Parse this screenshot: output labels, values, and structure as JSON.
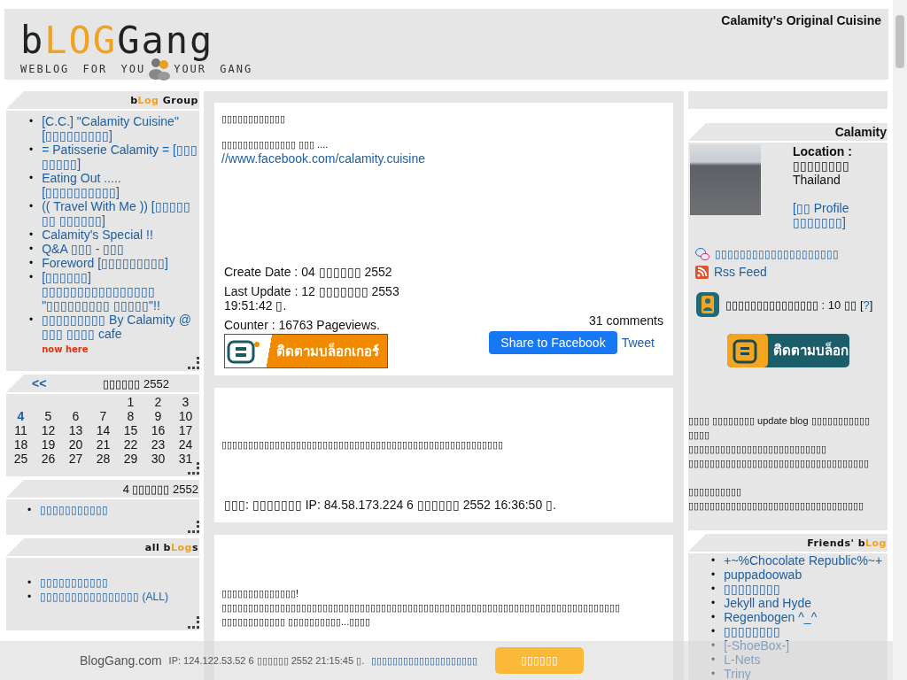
{
  "header": {
    "logo_parts": [
      {
        "text": "b",
        "accent": false
      },
      {
        "text": "LOG",
        "accent": true
      },
      {
        "text": "Gang",
        "accent": false
      }
    ],
    "tagline_left": "WEBLOG FOR YOU",
    "tagline_right": "YOUR GANG",
    "blog_title": "Calamity's Original Cuisine"
  },
  "left": {
    "group": {
      "title_parts": [
        {
          "text": "b",
          "accent": false
        },
        {
          "text": "Log",
          "accent": true
        },
        {
          "text": " Group",
          "accent": false
        }
      ],
      "marker": "•",
      "items": [
        {
          "text": "[C.C.] \"Calamity Cuisine\" [▯▯▯▯▯▯▯▯▯]"
        },
        {
          "text": "= Patisserie Calamity = [▯▯▯ ▯▯▯▯▯]"
        },
        {
          "text": "Eating Out ..... [▯▯▯▯▯▯▯▯▯▯]"
        },
        {
          "text": "(( Travel With Me )) [▯▯▯▯▯ ▯▯ ▯▯▯▯▯▯]"
        },
        {
          "text": "Calamity's Special !!"
        },
        {
          "text": "Q&A ▯▯▯ - ▯▯▯"
        },
        {
          "text": "Foreword [▯▯▯▯▯▯▯▯▯]"
        },
        {
          "text": "[▯▯▯▯▯▯] ▯▯▯▯▯▯▯▯▯▯▯▯▯▯▯▯ \"▯▯▯▯▯▯▯▯▯ ▯▯▯▯▯\"!!"
        },
        {
          "text": "▯▯▯▯▯▯▯▯▯ By Calamity @ ▯▯▯ ▯▯▯▯ cafe",
          "badge": "now here"
        }
      ]
    },
    "calendar": {
      "prev": "<<",
      "month": "▯▯▯▯▯▯ 2552",
      "weeks": [
        [
          {
            "kind": "blank"
          },
          {
            "kind": "blank"
          },
          {
            "kind": "blank"
          },
          {
            "kind": "blank"
          },
          {
            "kind": "day",
            "label": "1",
            "selected": false
          },
          {
            "kind": "day",
            "label": "2",
            "selected": false
          },
          {
            "kind": "day",
            "label": "3",
            "selected": false
          }
        ],
        [
          {
            "kind": "day",
            "label": "4",
            "selected": true
          },
          {
            "kind": "day",
            "label": "5",
            "selected": false
          },
          {
            "kind": "day",
            "label": "6",
            "selected": false
          },
          {
            "kind": "day",
            "label": "7",
            "selected": false
          },
          {
            "kind": "day",
            "label": "8",
            "selected": false
          },
          {
            "kind": "day",
            "label": "9",
            "selected": false
          },
          {
            "kind": "day",
            "label": "10",
            "selected": false
          }
        ],
        [
          {
            "kind": "day",
            "label": "11",
            "selected": false
          },
          {
            "kind": "day",
            "label": "12",
            "selected": false
          },
          {
            "kind": "day",
            "label": "13",
            "selected": false
          },
          {
            "kind": "day",
            "label": "14",
            "selected": false
          },
          {
            "kind": "day",
            "label": "15",
            "selected": false
          },
          {
            "kind": "day",
            "label": "16",
            "selected": false
          },
          {
            "kind": "day",
            "label": "17",
            "selected": false
          }
        ],
        [
          {
            "kind": "day",
            "label": "18",
            "selected": false
          },
          {
            "kind": "day",
            "label": "19",
            "selected": false
          },
          {
            "kind": "day",
            "label": "20",
            "selected": false
          },
          {
            "kind": "day",
            "label": "21",
            "selected": false
          },
          {
            "kind": "day",
            "label": "22",
            "selected": false
          },
          {
            "kind": "day",
            "label": "23",
            "selected": false
          },
          {
            "kind": "day",
            "label": "24",
            "selected": false
          }
        ],
        [
          {
            "kind": "day",
            "label": "25",
            "selected": false
          },
          {
            "kind": "day",
            "label": "26",
            "selected": false
          },
          {
            "kind": "day",
            "label": "27",
            "selected": false
          },
          {
            "kind": "day",
            "label": "28",
            "selected": false
          },
          {
            "kind": "day",
            "label": "29",
            "selected": false
          },
          {
            "kind": "day",
            "label": "30",
            "selected": false
          },
          {
            "kind": "day",
            "label": "31",
            "selected": false
          }
        ]
      ]
    },
    "day": {
      "title": "4 ▯▯▯▯▯▯ 2552",
      "marker": "•",
      "items": [
        "▯▯▯▯▯▯▯▯▯▯▯"
      ]
    },
    "all_blogs": {
      "title_parts": [
        {
          "text": "all b",
          "accent": false
        },
        {
          "text": "Log",
          "accent": true
        },
        {
          "text": "s",
          "accent": false
        }
      ],
      "marker": "•",
      "items": [
        "▯▯▯▯▯▯▯▯▯▯▯",
        "▯▯▯▯▯▯▯▯▯▯▯▯▯▯▯▯ (ALL)"
      ]
    }
  },
  "entry": {
    "title": "▯▯▯▯▯▯▯▯▯▯▯▯",
    "text": "▯▯▯▯▯▯▯▯▯▯▯▯▯▯ ▯▯▯ ....",
    "link": "//www.facebook.com/calamity.cuisine",
    "create_date": "Create Date : 04 ▯▯▯▯▯▯ 2552",
    "last_update": "Last Update : 12 ▯▯▯▯▯▯▯ 2553 19:51:42 ▯.",
    "counter": "Counter : 16763 Pageviews.",
    "comments": "31 comments",
    "follow_badge": "ติดตามบล็อกเกอร์",
    "share": "Share to Facebook",
    "tweet": "Tweet"
  },
  "comments": [
    {
      "text": "▯▯▯▯▯▯▯▯▯▯▯▯▯▯▯▯▯▯▯▯▯▯▯▯▯▯▯▯▯▯▯▯▯▯▯▯▯▯▯▯▯▯▯▯▯▯▯▯▯▯▯▯▯",
      "footer": "▯▯▯: ▯▯▯▯▯▯▯ IP: 84.58.173.224 6 ▯▯▯▯▯▯ 2552 16:36:50 ▯."
    },
    {
      "text": "▯▯▯▯▯▯▯▯▯▯▯▯▯▯! ▯▯▯▯▯▯▯▯▯▯▯▯▯▯▯▯▯▯▯▯▯▯▯▯▯▯▯▯▯▯▯▯▯▯▯▯▯▯▯▯▯▯▯▯▯▯▯▯▯▯▯▯▯▯▯▯▯▯▯▯▯▯▯▯▯▯▯▯▯▯▯▯▯▯▯ ▯▯▯▯▯▯▯▯▯▯▯▯ ▯▯▯▯▯▯▯▯▯▯...▯▯▯▯"
    }
  ],
  "right": {
    "profile": {
      "name": "Calamity",
      "location_label": "Location :",
      "location": "▯▯▯▯▯▯▯▯ Thailand",
      "profile_link": "[▯▯ Profile ▯▯▯▯▯▯▯]",
      "links": [
        {
          "kind": "chat",
          "text": "▯▯▯▯▯▯▯▯▯▯▯▯▯▯▯▯▯▯▯▯"
        },
        {
          "kind": "rss",
          "text": "Rss Feed"
        }
      ],
      "followers": "▯▯▯▯▯▯▯▯▯▯▯▯▯▯▯ : 10 ▯▯",
      "help_open": "[",
      "help": "?",
      "help_close": "]",
      "follow_button": "ติดตามบล็อก"
    },
    "about": [
      [
        "▯▯▯▯ ▯▯▯▯▯▯▯▯ update blog ▯▯▯▯▯▯▯▯▯▯▯ ▯▯▯▯",
        "▯▯▯▯▯▯▯▯▯▯▯▯▯▯▯▯▯▯▯▯▯▯▯▯▯▯",
        "▯▯▯▯▯▯▯▯▯▯▯▯▯▯▯▯▯▯▯▯▯▯▯▯▯▯▯▯▯▯▯▯▯▯"
      ],
      [
        "▯▯▯▯▯▯▯▯▯▯ ▯▯▯▯▯▯▯▯▯▯▯▯▯▯▯▯▯▯▯▯▯▯▯▯▯▯▯▯▯▯▯▯▯"
      ]
    ],
    "friends": {
      "title_parts": [
        {
          "text": "Friends' b",
          "accent": false
        },
        {
          "text": "Log",
          "accent": true
        }
      ],
      "marker": "•",
      "items": [
        "+~%Chocolate Republic%~+",
        "puppadoowab",
        "▯▯▯▯▯▯▯▯",
        "Jekyll and Hyde",
        "Regenbogen ^_^",
        "▯▯▯▯▯▯▯▯",
        "[-ShoeBox-]",
        "L-Nets",
        "Triny"
      ]
    }
  },
  "cookie_bar": {
    "site": "BlogGang.com",
    "ip": "IP: 124.122.53.52 6 ▯▯▯▯▯▯ 2552 21:15:45 ▯.",
    "link": "▯▯▯▯▯▯▯▯▯▯▯▯▯▯▯▯▯▯▯▯",
    "button": "▯▯▯▯▯▯"
  }
}
